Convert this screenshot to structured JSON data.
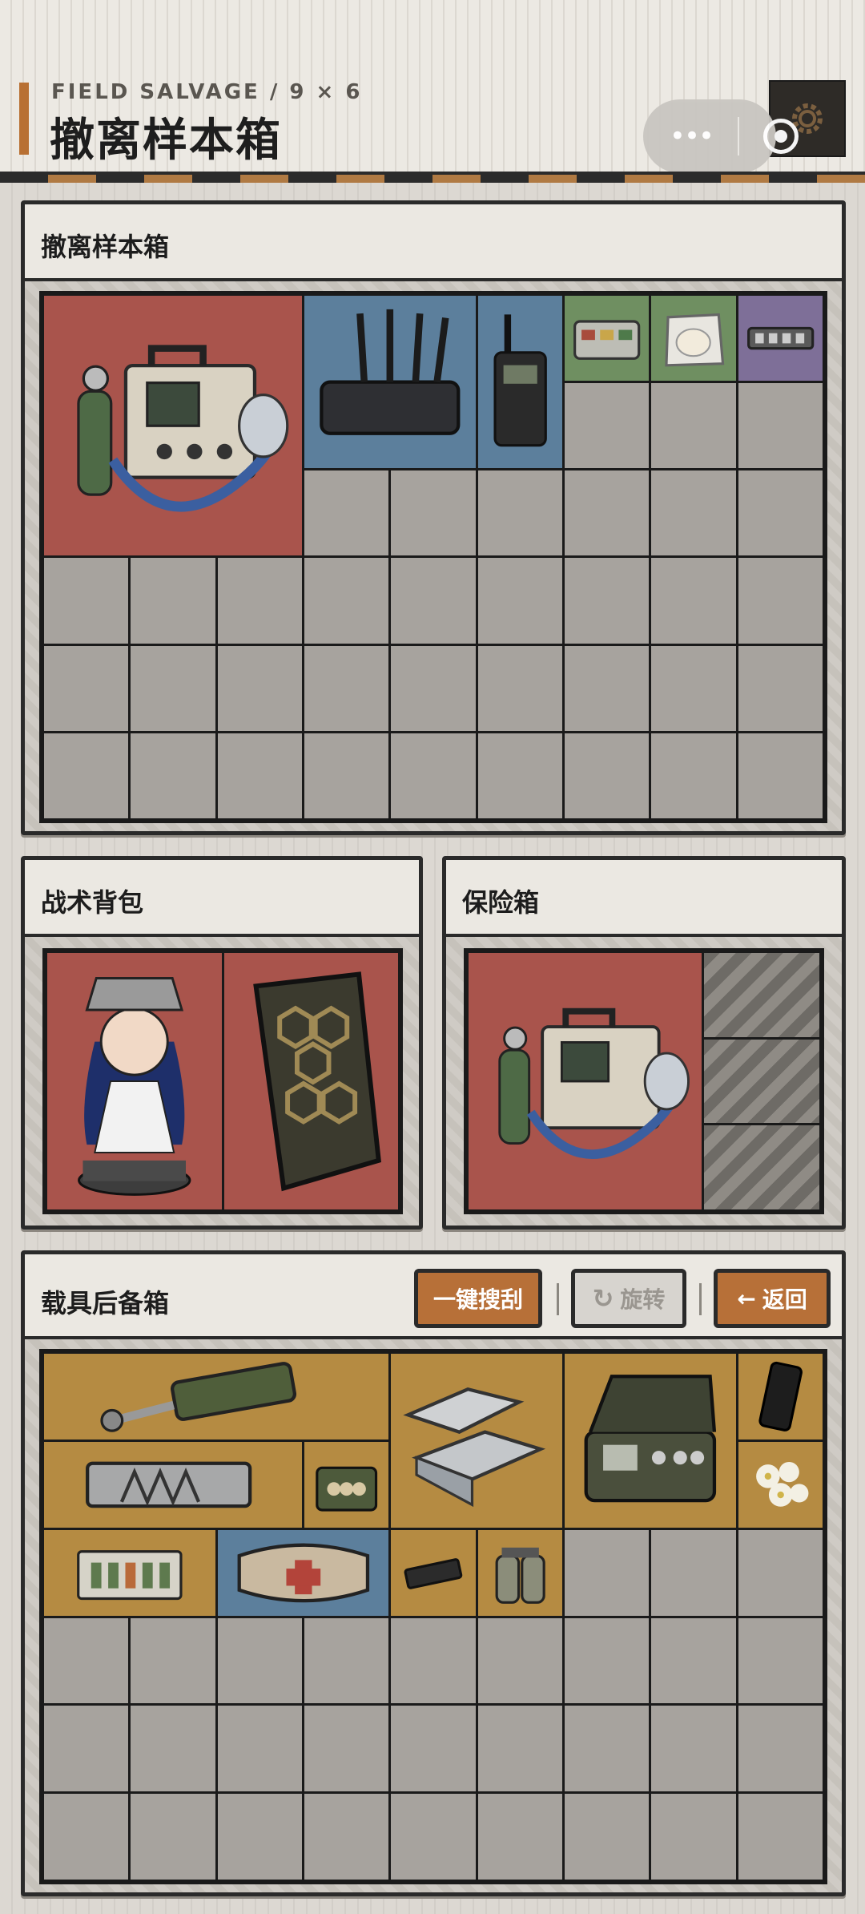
{
  "header": {
    "subtitle": "FIELD SALVAGE / 9 × 6",
    "title": "撤离样本箱",
    "capsule_more": "•••",
    "colors": {
      "accent": "#b87033"
    }
  },
  "extraction_case": {
    "title": "撤离样本箱",
    "grid": {
      "columns": 9,
      "rows": 6
    },
    "items": [
      {
        "name": "portable-oxygen-ventilator",
        "rarity": "red"
      },
      {
        "name": "wifi-router",
        "rarity": "blue"
      },
      {
        "name": "walkie-talkie",
        "rarity": "blue"
      },
      {
        "name": "component-tray",
        "rarity": "green"
      },
      {
        "name": "bandage-pack",
        "rarity": "green"
      },
      {
        "name": "memory-module",
        "rarity": "purple"
      }
    ]
  },
  "backpack": {
    "title": "战术背包",
    "items": [
      {
        "name": "anime-figurine",
        "rarity": "red"
      },
      {
        "name": "honeycomb-armor-plate",
        "rarity": "red"
      }
    ]
  },
  "safe_box": {
    "title": "保险箱",
    "items": [
      {
        "name": "portable-oxygen-ventilator",
        "rarity": "red"
      }
    ],
    "locked_slots": 3
  },
  "vehicle_box": {
    "title": "载具后备箱",
    "buttons": {
      "loot_all": "一键搜刮",
      "rotate": "旋转",
      "back": "返回"
    },
    "grid": {
      "columns": 9,
      "rows": 6
    },
    "items": [
      {
        "name": "hydraulic-cylinder",
        "rarity": "gold"
      },
      {
        "name": "metal-ingots",
        "rarity": "gold"
      },
      {
        "name": "equipment-case",
        "rarity": "gold"
      },
      {
        "name": "smartphone",
        "rarity": "gold"
      },
      {
        "name": "rail-component",
        "rarity": "gold"
      },
      {
        "name": "ammo-box",
        "rarity": "gold"
      },
      {
        "name": "white-flowers",
        "rarity": "gold"
      },
      {
        "name": "circuit-breaker-module",
        "rarity": "gold"
      },
      {
        "name": "first-aid-pouch",
        "rarity": "blue"
      },
      {
        "name": "ssd-drive",
        "rarity": "gold"
      },
      {
        "name": "gas-canisters",
        "rarity": "gold"
      }
    ]
  },
  "rarity_colors": {
    "red": "#a9544c",
    "blue": "#5c7f9c",
    "green": "#6f8f61",
    "purple": "#7e6f98",
    "gold": "#b58b42",
    "empty": "#a7a39e"
  }
}
